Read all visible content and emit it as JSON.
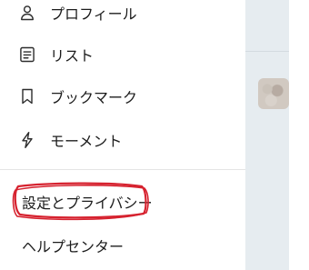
{
  "menu": {
    "items": [
      {
        "label": "プロフィール",
        "icon": "person-icon"
      },
      {
        "label": "リスト",
        "icon": "list-icon"
      },
      {
        "label": "ブックマーク",
        "icon": "bookmark-icon"
      },
      {
        "label": "モーメント",
        "icon": "lightning-icon"
      }
    ]
  },
  "secondary": {
    "settings_label": "設定とプライバシー",
    "help_label": "ヘルプセンター"
  },
  "highlight": {
    "color": "#d6222f"
  }
}
